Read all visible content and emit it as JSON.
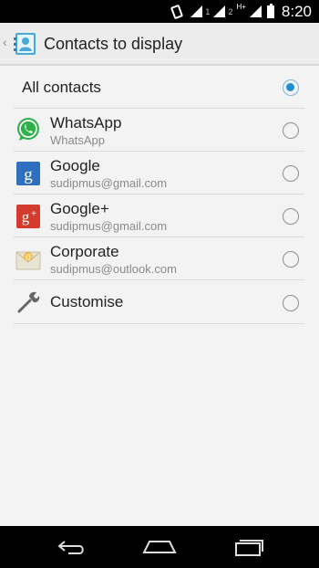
{
  "status_bar": {
    "sim1_label": "1",
    "sim2_label": "2",
    "hd_label": "H+",
    "time": "8:20"
  },
  "action_bar": {
    "title": "Contacts to display",
    "back_icon": "chevron-left-icon",
    "app_icon": "contacts-app-icon"
  },
  "options": {
    "all_contacts": {
      "label": "All contacts",
      "selected": true
    },
    "accounts": [
      {
        "title": "WhatsApp",
        "subtitle": "WhatsApp",
        "icon": "whatsapp-icon",
        "selected": false
      },
      {
        "title": "Google",
        "subtitle": "sudipmus@gmail.com",
        "icon": "google-icon",
        "selected": false
      },
      {
        "title": "Google+",
        "subtitle": "sudipmus@gmail.com",
        "icon": "google-plus-icon",
        "selected": false
      },
      {
        "title": "Corporate",
        "subtitle": "sudipmus@outlook.com",
        "icon": "corporate-mail-icon",
        "selected": false
      }
    ],
    "customise": {
      "label": "Customise",
      "icon": "wrench-icon",
      "selected": false
    }
  },
  "nav_bar": {
    "back_icon": "back-icon",
    "home_icon": "home-icon",
    "recents_icon": "recents-icon"
  },
  "colors": {
    "accent": "#1f8fd0",
    "action_bar_bg": "#ececec",
    "content_bg": "#f3f3f3",
    "whatsapp": "#2fb14a",
    "google": "#2f6fbf",
    "google_plus": "#d43b2f"
  }
}
